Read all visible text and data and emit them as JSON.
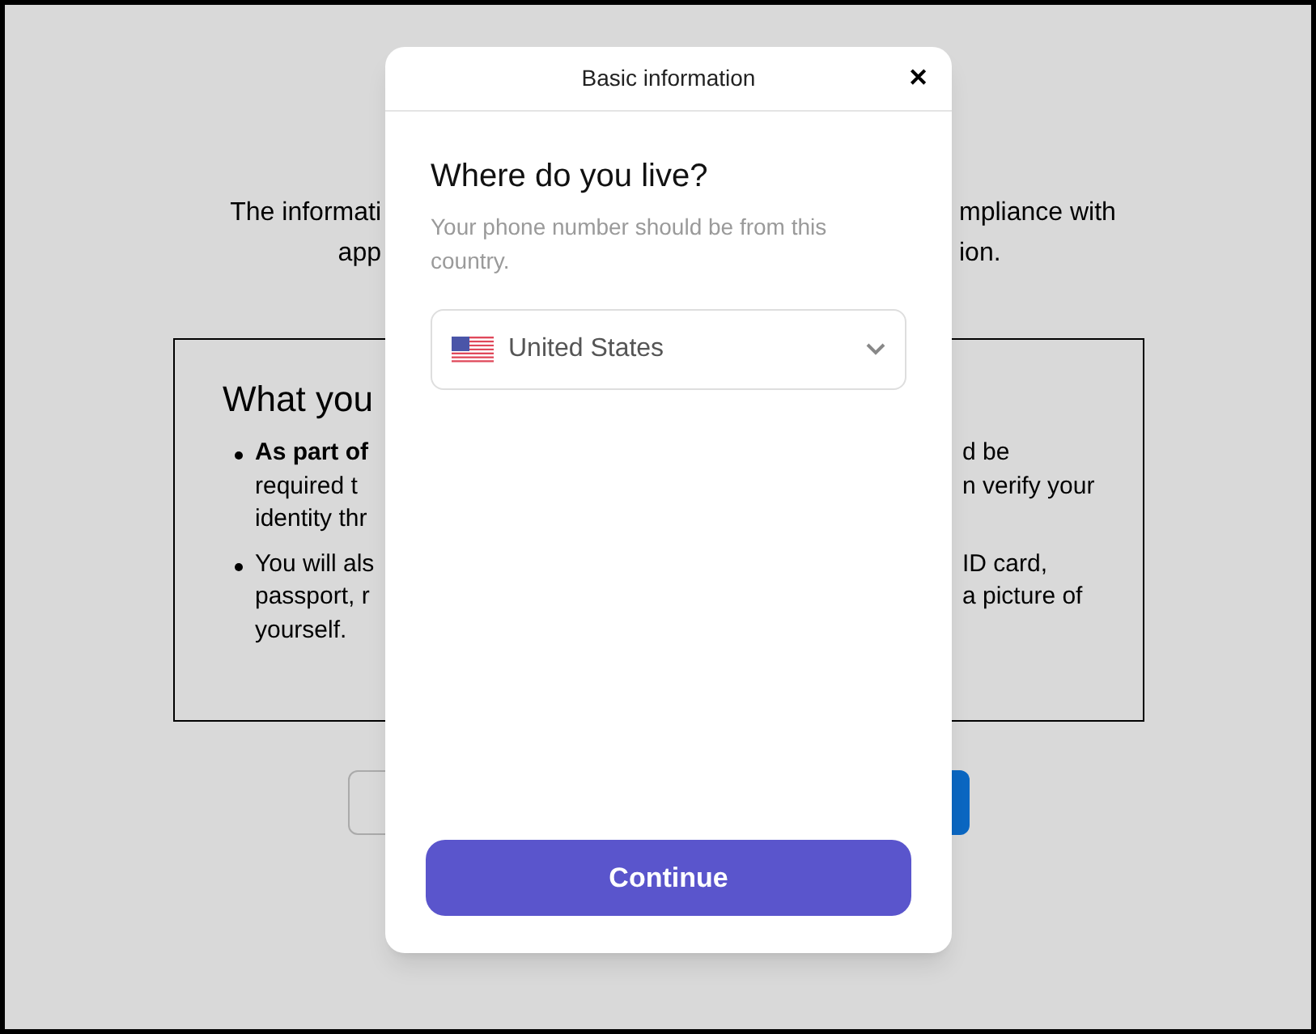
{
  "background_page": {
    "intro_lines": [
      {
        "left": "The informati",
        "right": "mpliance with"
      },
      {
        "left": "app",
        "right": "ion."
      }
    ],
    "info_box": {
      "title": "What you",
      "bullets": [
        {
          "lines": [
            {
              "left": "As part of",
              "right": "d be",
              "bold_left": true
            },
            {
              "left": "required t",
              "right": "n verify your",
              "bold_left": false
            },
            {
              "left": "identity thr",
              "bold_left": false
            }
          ]
        },
        {
          "lines": [
            {
              "left": "You will als",
              "right": "ID card,",
              "bold_left": false
            },
            {
              "left": "passport, r",
              "right": "a picture of",
              "bold_left": false
            },
            {
              "left": "yourself.",
              "bold_left": false
            }
          ]
        }
      ]
    },
    "buttons": [
      {
        "kind": "secondary"
      },
      {
        "kind": "primary"
      }
    ]
  },
  "modal": {
    "title": "Basic information",
    "close": "✕",
    "heading": "Where do you live?",
    "description": "Your phone number should be from this country.",
    "country_select": {
      "value": "United States"
    },
    "continue_button": "Continue"
  }
}
